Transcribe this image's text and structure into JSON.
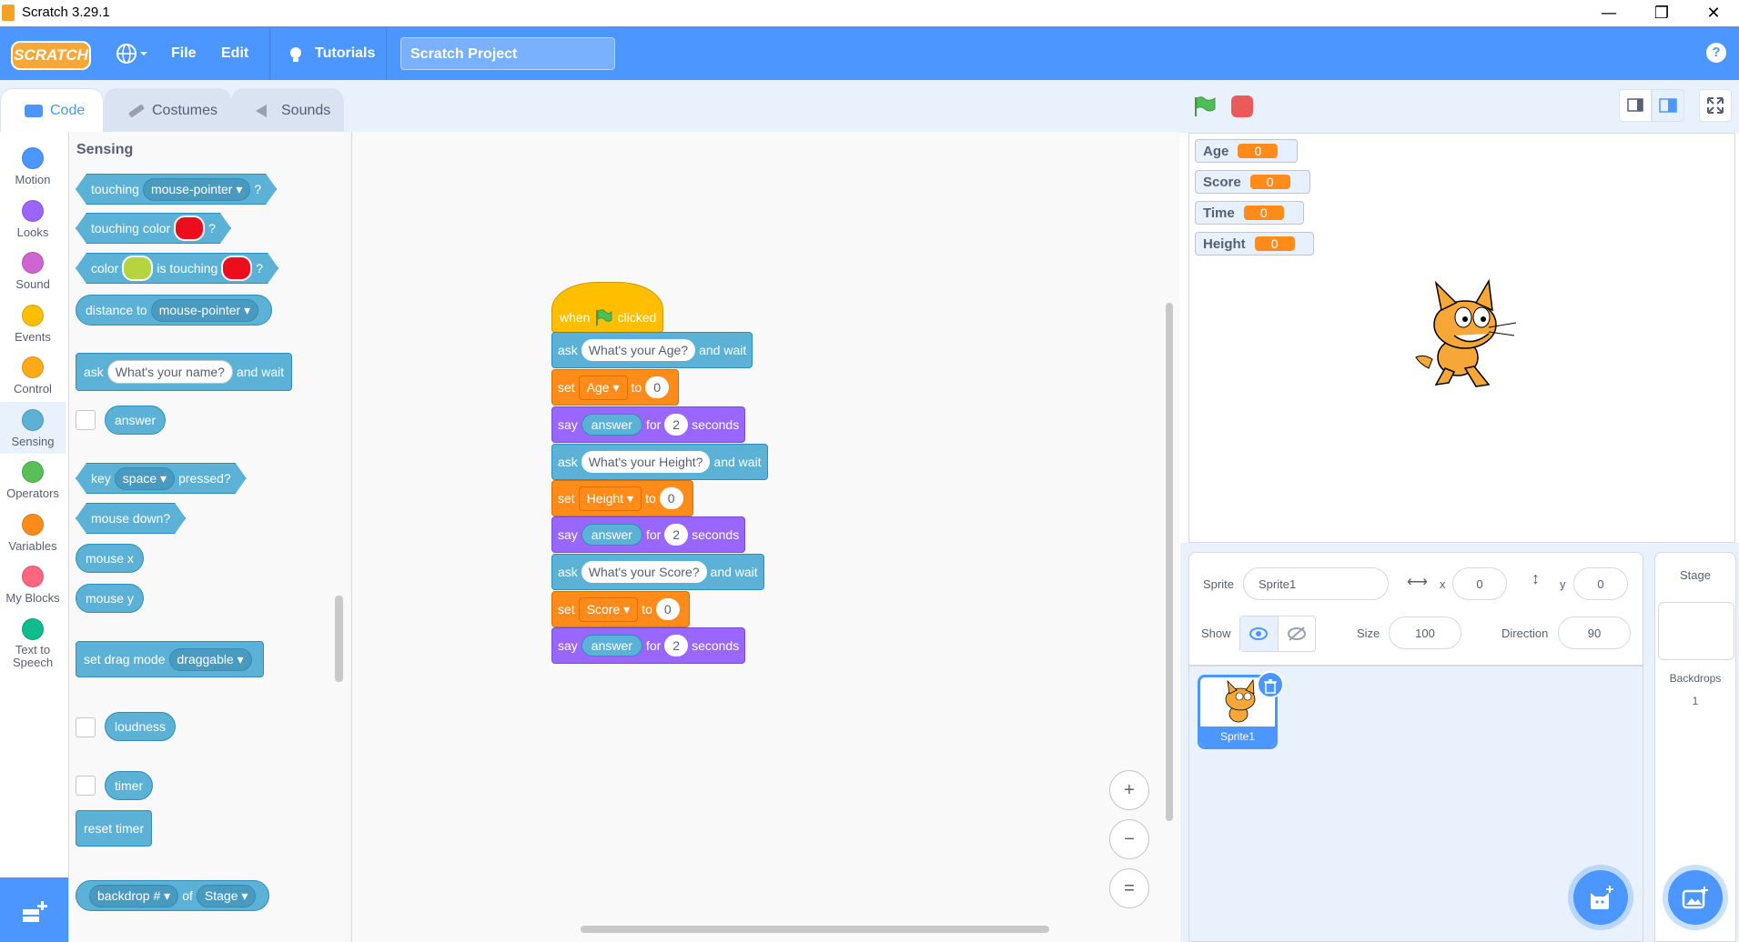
{
  "window": {
    "title": "Scratch 3.29.1",
    "min": "—",
    "restore": "❐",
    "close": "✕"
  },
  "menubar": {
    "logo": "SCRATCH",
    "language_icon": "globe-icon",
    "file": "File",
    "edit": "Edit",
    "tutorials": "Tutorials",
    "project_title": "Scratch Project",
    "help": "?"
  },
  "tabs": {
    "code": "Code",
    "costumes": "Costumes",
    "sounds": "Sounds"
  },
  "categories": [
    {
      "label": "Motion",
      "color": "#4c97ff"
    },
    {
      "label": "Looks",
      "color": "#9966ff"
    },
    {
      "label": "Sound",
      "color": "#cf63cf"
    },
    {
      "label": "Events",
      "color": "#ffbf00"
    },
    {
      "label": "Control",
      "color": "#ffab19"
    },
    {
      "label": "Sensing",
      "color": "#5cb1d6"
    },
    {
      "label": "Operators",
      "color": "#59c059"
    },
    {
      "label": "Variables",
      "color": "#ff8c1a"
    },
    {
      "label": "My Blocks",
      "color": "#ff6680"
    },
    {
      "label": "Text to Speech",
      "color": "#0fbd8c"
    }
  ],
  "palette": {
    "title": "Sensing",
    "touching": {
      "label": "touching",
      "menu": "mouse-pointer",
      "q": "?"
    },
    "touching_color": {
      "label": "touching color",
      "q": "?",
      "swatch": "#ec0d1d"
    },
    "color_touching": {
      "label1": "color",
      "label2": "is touching",
      "q": "?",
      "swatch1": "#b5d43f",
      "swatch2": "#ec0d1d"
    },
    "distance": {
      "label": "distance to",
      "menu": "mouse-pointer"
    },
    "ask": {
      "label": "ask",
      "input": "What's your name?",
      "suffix": "and wait"
    },
    "answer": "answer",
    "key_pressed": {
      "label": "key",
      "menu": "space",
      "suffix": "pressed?"
    },
    "mouse_down": "mouse down?",
    "mouse_x": "mouse x",
    "mouse_y": "mouse y",
    "drag_mode": {
      "label": "set drag mode",
      "menu": "draggable"
    },
    "loudness": "loudness",
    "timer": "timer",
    "reset_timer": "reset timer",
    "backdrop": {
      "menu1": "backdrop #",
      "of": "of",
      "menu2": "Stage"
    }
  },
  "script": {
    "hat": {
      "when": "when",
      "clicked": "clicked"
    },
    "b1": {
      "op": "ask",
      "input": "What's your Age?",
      "suffix": "and wait"
    },
    "b2": {
      "op": "set",
      "var": "Age",
      "to": "to",
      "value": "0"
    },
    "b3": {
      "op": "say",
      "reporter": "answer",
      "for": "for",
      "secs": "2",
      "suffix": "seconds"
    },
    "b4": {
      "op": "ask",
      "input": "What's your Height?",
      "suffix": "and wait"
    },
    "b5": {
      "op": "set",
      "var": "Height",
      "to": "to",
      "value": "0"
    },
    "b6": {
      "op": "say",
      "reporter": "answer",
      "for": "for",
      "secs": "2",
      "suffix": "seconds"
    },
    "b7": {
      "op": "ask",
      "input": "What's your Score?",
      "suffix": "and wait"
    },
    "b8": {
      "op": "set",
      "var": "Score",
      "to": "to",
      "value": "0"
    },
    "b9": {
      "op": "say",
      "reporter": "answer",
      "for": "for",
      "secs": "2",
      "suffix": "seconds"
    }
  },
  "zoom": {
    "in": "+",
    "out": "−",
    "reset": "="
  },
  "monitors": [
    {
      "name": "Age",
      "value": "0"
    },
    {
      "name": "Score",
      "value": "0"
    },
    {
      "name": "Time",
      "value": "0"
    },
    {
      "name": "Height",
      "value": "0"
    }
  ],
  "sprite_info": {
    "sprite_label": "Sprite",
    "sprite_name": "Sprite1",
    "x_label": "x",
    "x": "0",
    "y_label": "y",
    "y": "0",
    "show_label": "Show",
    "size_label": "Size",
    "size": "100",
    "direction_label": "Direction",
    "direction": "90"
  },
  "sprites": [
    {
      "name": "Sprite1"
    }
  ],
  "stage_panel": {
    "title": "Stage",
    "backdrops_label": "Backdrops",
    "backdrops_count": "1"
  }
}
